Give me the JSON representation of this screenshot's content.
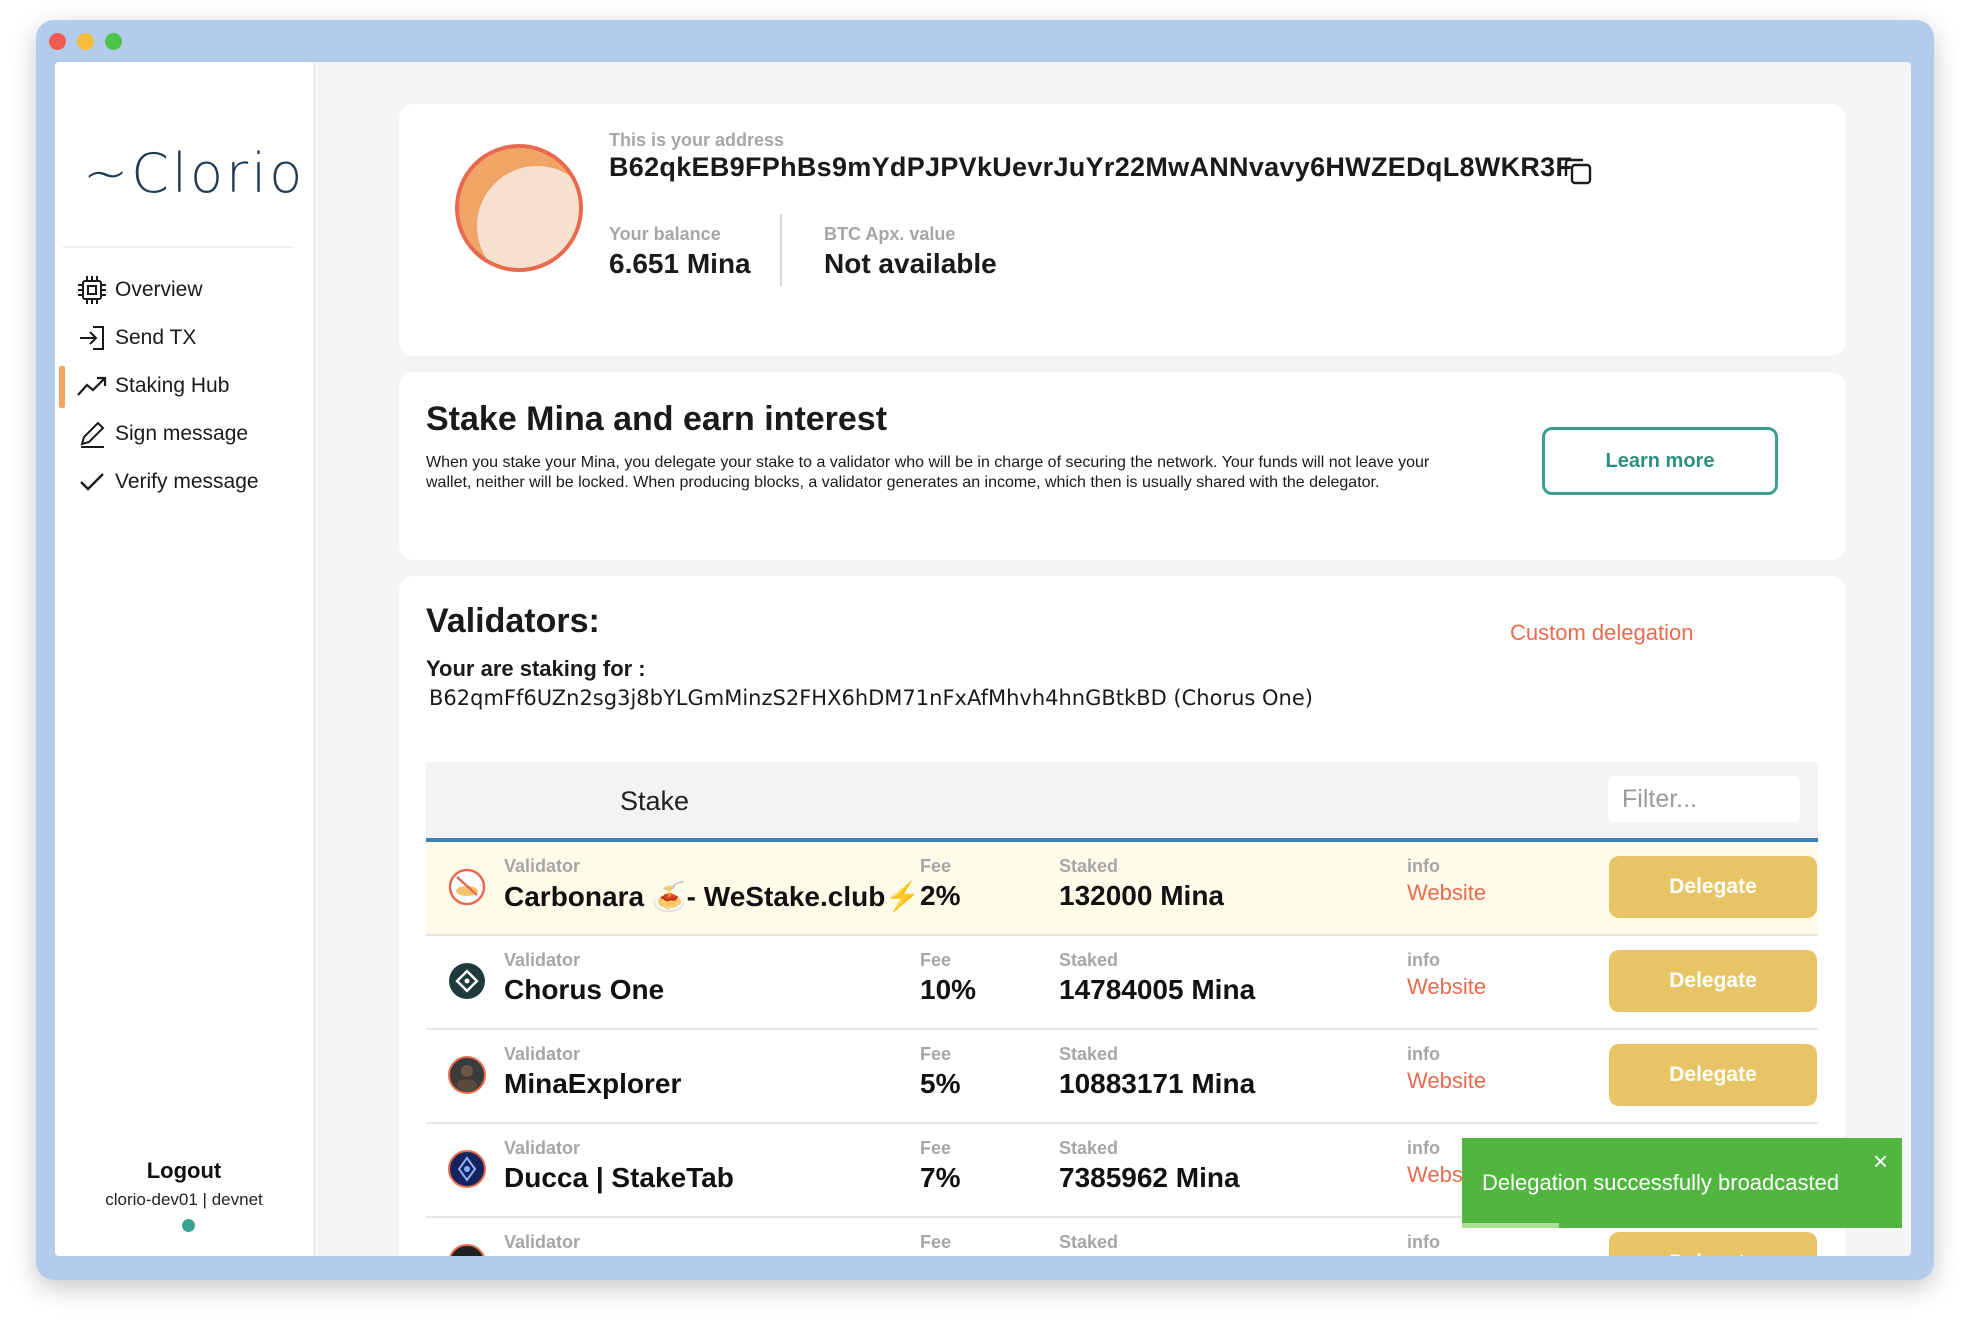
{
  "sidebar": {
    "logo": "~Clorio",
    "items": [
      {
        "label": "Overview",
        "icon": "chip-icon"
      },
      {
        "label": "Send TX",
        "icon": "send-icon"
      },
      {
        "label": "Staking Hub",
        "icon": "trend-up-icon",
        "active": true
      },
      {
        "label": "Sign message",
        "icon": "pen-icon"
      },
      {
        "label": "Verify message",
        "icon": "check-icon"
      }
    ],
    "logout": "Logout",
    "account": "clorio-dev01 | devnet"
  },
  "address_card": {
    "address_label": "This is your address",
    "address": "B62qkEB9FPhBs9mYdPJPVkUevrJuYr22MwANNvavy6HWZEDqL8WKR3F",
    "balance_label": "Your balance",
    "balance": "6.651 Mina",
    "btc_label": "BTC Apx. value",
    "btc_value": "Not available"
  },
  "stake_info": {
    "title": "Stake Mina and earn interest",
    "description": "When you stake your Mina, you delegate your stake to a validator who will be in charge of securing the network. Your funds will not leave your wallet, neither will be locked. When producing blocks, a validator generates an income, which then is usually shared with the delegator.",
    "learn_more": "Learn more"
  },
  "validators": {
    "title": "Validators:",
    "custom_delegation": "Custom delegation",
    "staking_for_label": "Your are staking for :",
    "staking_for_value": "B62qmFf6UZn2sg3j8bYLGmMinzS2FHX6hDM71nFxAfMhvh4hnGBtkBD (Chorus One)",
    "tab_stake": "Stake",
    "filter_placeholder": "Filter...",
    "labels": {
      "validator": "Validator",
      "fee": "Fee",
      "staked": "Staked",
      "info": "info",
      "website": "Website",
      "delegate": "Delegate"
    },
    "rows": [
      {
        "name": "Carbonara 🍝- WeStake.club⚡",
        "fee": "2%",
        "staked": "132000 Mina"
      },
      {
        "name": "Chorus One",
        "fee": "10%",
        "staked": "14784005 Mina"
      },
      {
        "name": "MinaExplorer",
        "fee": "5%",
        "staked": "10883171 Mina"
      },
      {
        "name": "Ducca | StakeTab",
        "fee": "7%",
        "staked": "7385962 Mina"
      },
      {
        "name": "",
        "fee": "",
        "staked": ""
      }
    ]
  },
  "toast": {
    "message": "Delegation successfully broadcasted",
    "close": "×",
    "progress": 0.22
  },
  "colors": {
    "accent_orange": "#e86a4f",
    "teal": "#3a9e91",
    "delegate_yellow": "#e7c466",
    "toast_green": "#51b63f"
  }
}
